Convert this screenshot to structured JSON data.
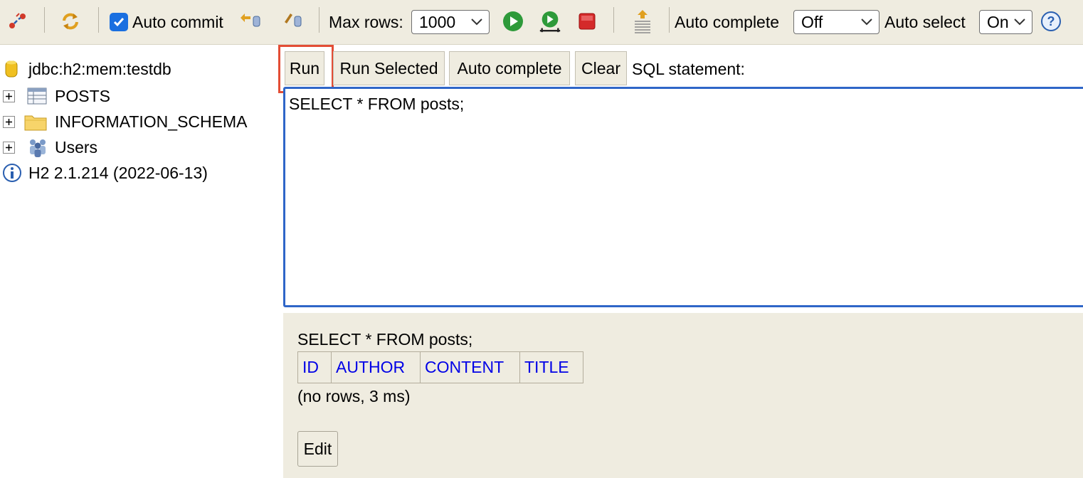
{
  "toolbar": {
    "icons": {
      "disconnect": "disconnect-icon",
      "refresh": "refresh-icon",
      "rollback": "rollback-icon",
      "commit": "commit-icon",
      "run": "run-icon",
      "run_selected": "run-selected-icon",
      "stop": "stop-icon",
      "history": "history-icon",
      "help": "help-icon"
    },
    "auto_commit_label": "Auto commit",
    "auto_commit_checked": true,
    "max_rows_label": "Max rows:",
    "max_rows_value": "1000",
    "auto_complete_label": "Auto complete",
    "auto_complete_value": "Off",
    "auto_select_label": "Auto select",
    "auto_select_value": "On"
  },
  "tree": {
    "connection": "jdbc:h2:mem:testdb",
    "items": [
      {
        "label": "POSTS",
        "icon": "table-icon"
      },
      {
        "label": "INFORMATION_SCHEMA",
        "icon": "folder-icon"
      },
      {
        "label": "Users",
        "icon": "users-icon"
      }
    ],
    "version": "H2 2.1.214 (2022-06-13)"
  },
  "editor": {
    "buttons": {
      "run": "Run",
      "run_selected": "Run Selected",
      "auto_complete": "Auto complete",
      "clear": "Clear"
    },
    "sql_label": "SQL statement:",
    "sql_text": "SELECT * FROM posts;"
  },
  "result": {
    "query": "SELECT * FROM posts;",
    "columns": [
      "ID",
      "AUTHOR",
      "CONTENT",
      "TITLE"
    ],
    "status": "(no rows, 3 ms)",
    "edit_label": "Edit"
  },
  "colors": {
    "toolbar_bg": "#efece0",
    "editor_border": "#2f66c8",
    "highlight": "#e34d35",
    "link": "#0000e6"
  }
}
